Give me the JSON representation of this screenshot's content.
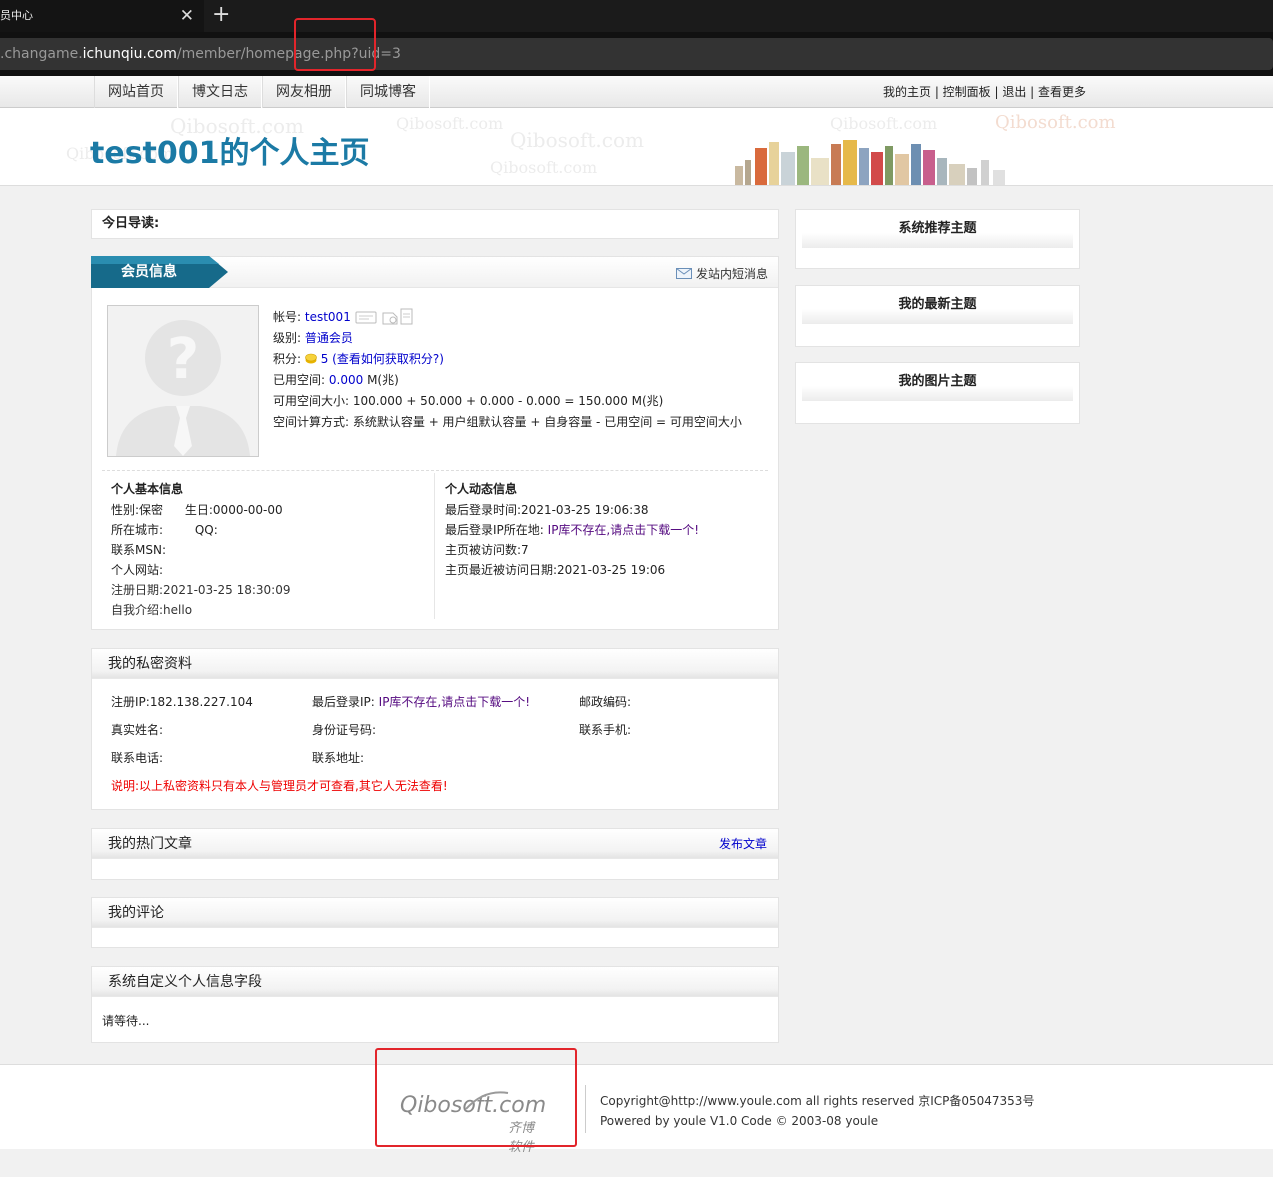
{
  "browser": {
    "tab_title": "员中心",
    "url_prefix": ".changame.",
    "url_host": "ichunqiu.com",
    "url_path": "/member/homepage.php?uid=3"
  },
  "topnav": {
    "links": [
      "网站首页",
      "博文日志",
      "网友相册",
      "同城博客"
    ],
    "user_links": "我的主页 | 控制面板 | 退出 | 查看更多"
  },
  "banner": {
    "title": "test001的个人主页",
    "watermark": "Qibosoft.com"
  },
  "today": {
    "label": "今日导读:"
  },
  "member": {
    "tab_label": "会员信息",
    "send_msg": "发站内短消息",
    "account_label": "帐号:",
    "account_value": "test001",
    "level_label": "级别:",
    "level_value": "普通会员",
    "points_label": "积分:",
    "points_value": "5",
    "points_link": "(查看如何获取积分?)",
    "used_label": "已用空间:",
    "used_value": "0.000",
    "used_unit": "M(兆)",
    "avail_label": "可用空间大小:",
    "avail_value": "100.000 + 50.000 + 0.000 - 0.000 = 150.000 M(兆)",
    "calc_label": "空间计算方式:",
    "calc_value": "系统默认容量 + 用户组默认容量 + 自身容量 - 已用空间 = 可用空间大小"
  },
  "basic": {
    "heading": "个人基本信息",
    "gender": "性别:保密",
    "birthday": "生日:0000-00-00",
    "city": "所在城市:",
    "qq": "QQ:",
    "msn": "联系MSN:",
    "site": "个人网站:",
    "reg_date": "注册日期:2021-03-25 18:30:09",
    "intro": "自我介绍:hello"
  },
  "dynamic": {
    "heading": "个人动态信息",
    "last_login": "最后登录时间:2021-03-25 19:06:38",
    "last_ip_label": "最后登录IP所在地:",
    "last_ip_value": "IP库不存在,请点击下载一个!",
    "visits": "主页被访问数:7",
    "last_visit": "主页最近被访问日期:2021-03-25 19:06"
  },
  "private": {
    "title": "我的私密资料",
    "reg_ip": "注册IP:182.138.227.104",
    "last_ip_label": "最后登录IP:",
    "last_ip_value": "IP库不存在,请点击下载一个!",
    "postcode": "邮政编码:",
    "realname": "真实姓名:",
    "idcard": "身份证号码:",
    "mobile": "联系手机:",
    "phone": "联系电话:",
    "address": "联系地址:",
    "note": "说明:以上私密资料只有本人与管理员才可查看,其它人无法查看!"
  },
  "hot": {
    "title": "我的热门文章",
    "publish": "发布文章"
  },
  "comments": {
    "title": "我的评论"
  },
  "custom": {
    "title": "系统自定义个人信息字段",
    "loading": "请等待..."
  },
  "right": {
    "recommend": "系统推荐主题",
    "latest": "我的最新主题",
    "pictures": "我的图片主题"
  },
  "footer": {
    "logo_text": "Qibosoft",
    "logo_com": ".com",
    "logo_cn": "齐博软件",
    "copyright": "Copyright@http://www.youle.com all rights reserved 京ICP备05047353号",
    "powered": "Powered by youle V1.0 Code © 2003-08 youle"
  },
  "colors": {
    "accent": "#1b7aa5",
    "highlight_box": "#e2252b"
  }
}
